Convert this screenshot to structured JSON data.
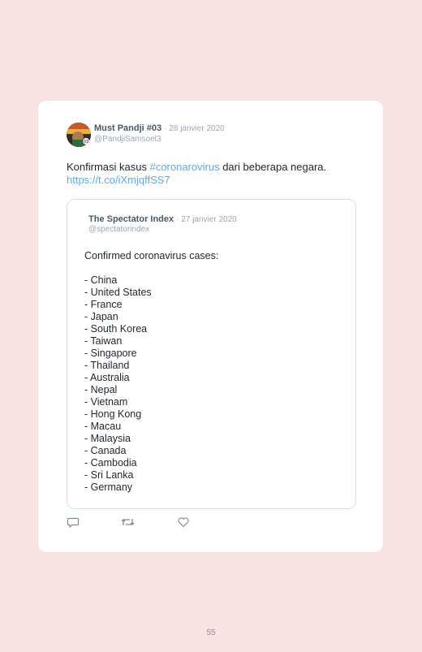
{
  "tweet": {
    "author_name": "Must Pandji #03",
    "date": "· 28 janvier 2020",
    "handle": "@PandjiSamsoel3",
    "text": "Konfirmasi kasus ",
    "hashtag": "#coronarovirus",
    "text_after": " dari beberapa negara.",
    "url": "https://t.co/iXmjqffSS7"
  },
  "quoted_tweet": {
    "author_name": "The Spectator Index",
    "date": "· 27 janvier 2020",
    "handle": "@spectatorindex",
    "intro": "Confirmed coronavirus cases:",
    "countries": [
      "- China",
      "- United States",
      "- France",
      "- Japan",
      "- South Korea",
      "- Taiwan",
      "- Singapore",
      "- Thailand",
      "- Australia",
      "- Nepal",
      "- Vietnam",
      "- Hong Kong",
      "- Macau",
      "- Malaysia",
      "- Canada",
      "- Cambodia",
      "- Sri Lanka",
      "- Germany"
    ]
  },
  "actions": {
    "reply_icon": "reply-icon",
    "retweet_icon": "retweet-icon",
    "like_icon": "heart-icon"
  },
  "page_number": "55",
  "colors": {
    "background": "#f8e3e2",
    "link": "#55acee",
    "muted": "#9aa6b1"
  }
}
